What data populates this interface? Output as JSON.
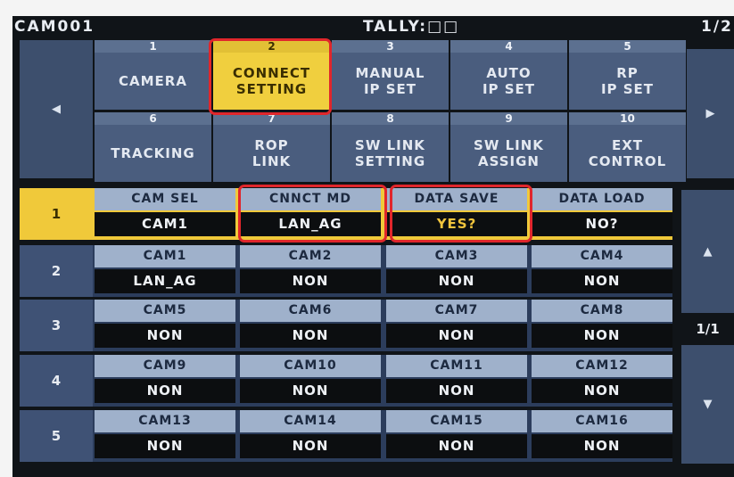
{
  "header": {
    "cam_id": "CAM001",
    "tally": "TALLY:□□",
    "page": "1/2"
  },
  "nav": {
    "left_arrow": "◀",
    "right_arrow": "▶",
    "up_arrow": "▲",
    "down_arrow": "▼",
    "list_page": "1/1"
  },
  "menu": [
    {
      "num": "1",
      "line1": "CAMERA",
      "line2": ""
    },
    {
      "num": "2",
      "line1": "CONNECT",
      "line2": "SETTING"
    },
    {
      "num": "3",
      "line1": "MANUAL",
      "line2": "IP SET"
    },
    {
      "num": "4",
      "line1": "AUTO",
      "line2": "IP SET"
    },
    {
      "num": "5",
      "line1": "RP",
      "line2": "IP SET"
    },
    {
      "num": "6",
      "line1": "TRACKING",
      "line2": ""
    },
    {
      "num": "7",
      "line1": "ROP",
      "line2": "LINK"
    },
    {
      "num": "8",
      "line1": "SW LINK",
      "line2": "SETTING"
    },
    {
      "num": "9",
      "line1": "SW LINK",
      "line2": "ASSIGN"
    },
    {
      "num": "10",
      "line1": "EXT",
      "line2": "CONTROL"
    }
  ],
  "rows": [
    {
      "num": "1",
      "cells": [
        {
          "label": "CAM SEL",
          "value": "CAM1"
        },
        {
          "label": "CNNCT MD",
          "value": "LAN_AG"
        },
        {
          "label": "DATA SAVE",
          "value": "YES?"
        },
        {
          "label": "DATA LOAD",
          "value": "NO?"
        }
      ]
    },
    {
      "num": "2",
      "cells": [
        {
          "label": "CAM1",
          "value": "LAN_AG"
        },
        {
          "label": "CAM2",
          "value": "NON"
        },
        {
          "label": "CAM3",
          "value": "NON"
        },
        {
          "label": "CAM4",
          "value": "NON"
        }
      ]
    },
    {
      "num": "3",
      "cells": [
        {
          "label": "CAM5",
          "value": "NON"
        },
        {
          "label": "CAM6",
          "value": "NON"
        },
        {
          "label": "CAM7",
          "value": "NON"
        },
        {
          "label": "CAM8",
          "value": "NON"
        }
      ]
    },
    {
      "num": "4",
      "cells": [
        {
          "label": "CAM9",
          "value": "NON"
        },
        {
          "label": "CAM10",
          "value": "NON"
        },
        {
          "label": "CAM11",
          "value": "NON"
        },
        {
          "label": "CAM12",
          "value": "NON"
        }
      ]
    },
    {
      "num": "5",
      "cells": [
        {
          "label": "CAM13",
          "value": "NON"
        },
        {
          "label": "CAM14",
          "value": "NON"
        },
        {
          "label": "CAM15",
          "value": "NON"
        },
        {
          "label": "CAM16",
          "value": "NON"
        }
      ]
    }
  ],
  "colors": {
    "active_tab": "#f0cf3e",
    "highlight": "#e0262b",
    "yes_text": "#f2c53d"
  }
}
